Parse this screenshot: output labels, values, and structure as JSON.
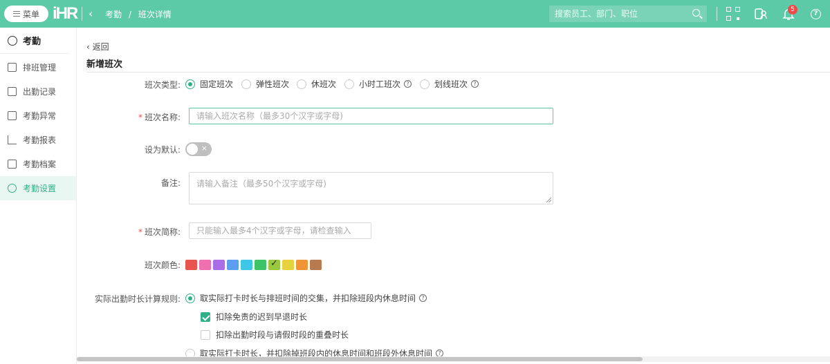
{
  "header": {
    "menu_label": "菜单",
    "logo_text": "iHR",
    "breadcrumb": [
      "考勤",
      "/",
      "班次详情"
    ],
    "search_placeholder": "搜索员工、部门、职位",
    "notification_count": "5",
    "help_glyph": "?"
  },
  "sidebar": {
    "title": "考勤",
    "items": [
      {
        "label": "排班管理",
        "icon": "schedule-icon"
      },
      {
        "label": "出勤记录",
        "icon": "record-icon"
      },
      {
        "label": "考勤异常",
        "icon": "exception-icon"
      },
      {
        "label": "考勤报表",
        "icon": "chart-icon"
      },
      {
        "label": "考勤档案",
        "icon": "archive-icon"
      },
      {
        "label": "考勤设置",
        "icon": "settings-icon",
        "active": true
      }
    ]
  },
  "page": {
    "back_label": "返回",
    "title": "新增班次"
  },
  "form": {
    "shift_type": {
      "label": "班次类型:",
      "options": [
        "固定班次",
        "弹性班次",
        "休班次",
        "小时工班次",
        "划线班次"
      ],
      "selected": "固定班次"
    },
    "shift_name": {
      "label": "班次名称:",
      "placeholder": "请输入班次名称（最多30个汉字或字母)"
    },
    "default": {
      "label": "设为默认:",
      "value": false
    },
    "remark": {
      "label": "备注:",
      "placeholder": "请输入备注（最多50个汉字或字母)"
    },
    "short_name": {
      "label": "班次简称:",
      "placeholder": "只能输入最多4个汉字或字母，请检查输入"
    },
    "color": {
      "label": "班次颜色:",
      "swatches": [
        "#e8554e",
        "#f06fb0",
        "#a96ee6",
        "#5b9ef0",
        "#3ec6e6",
        "#3cc467",
        "#9ac93f",
        "#e6d23e",
        "#ef9535",
        "#b87a4f"
      ],
      "selected_index": 6
    },
    "calc_rule": {
      "label": "实际出勤时长计算规则:",
      "option1": "取实际打卡时长与排班时间的交集，并扣除班段内休息时间",
      "checkbox1": "扣除免责的迟到早退时长",
      "checkbox1_checked": true,
      "checkbox2": "扣除出勤时段与请假时段的重叠时长",
      "checkbox2_checked": false,
      "option2": "取实际打卡时长，并扣除掉班段内的休息时间和班段外休息时间"
    }
  }
}
